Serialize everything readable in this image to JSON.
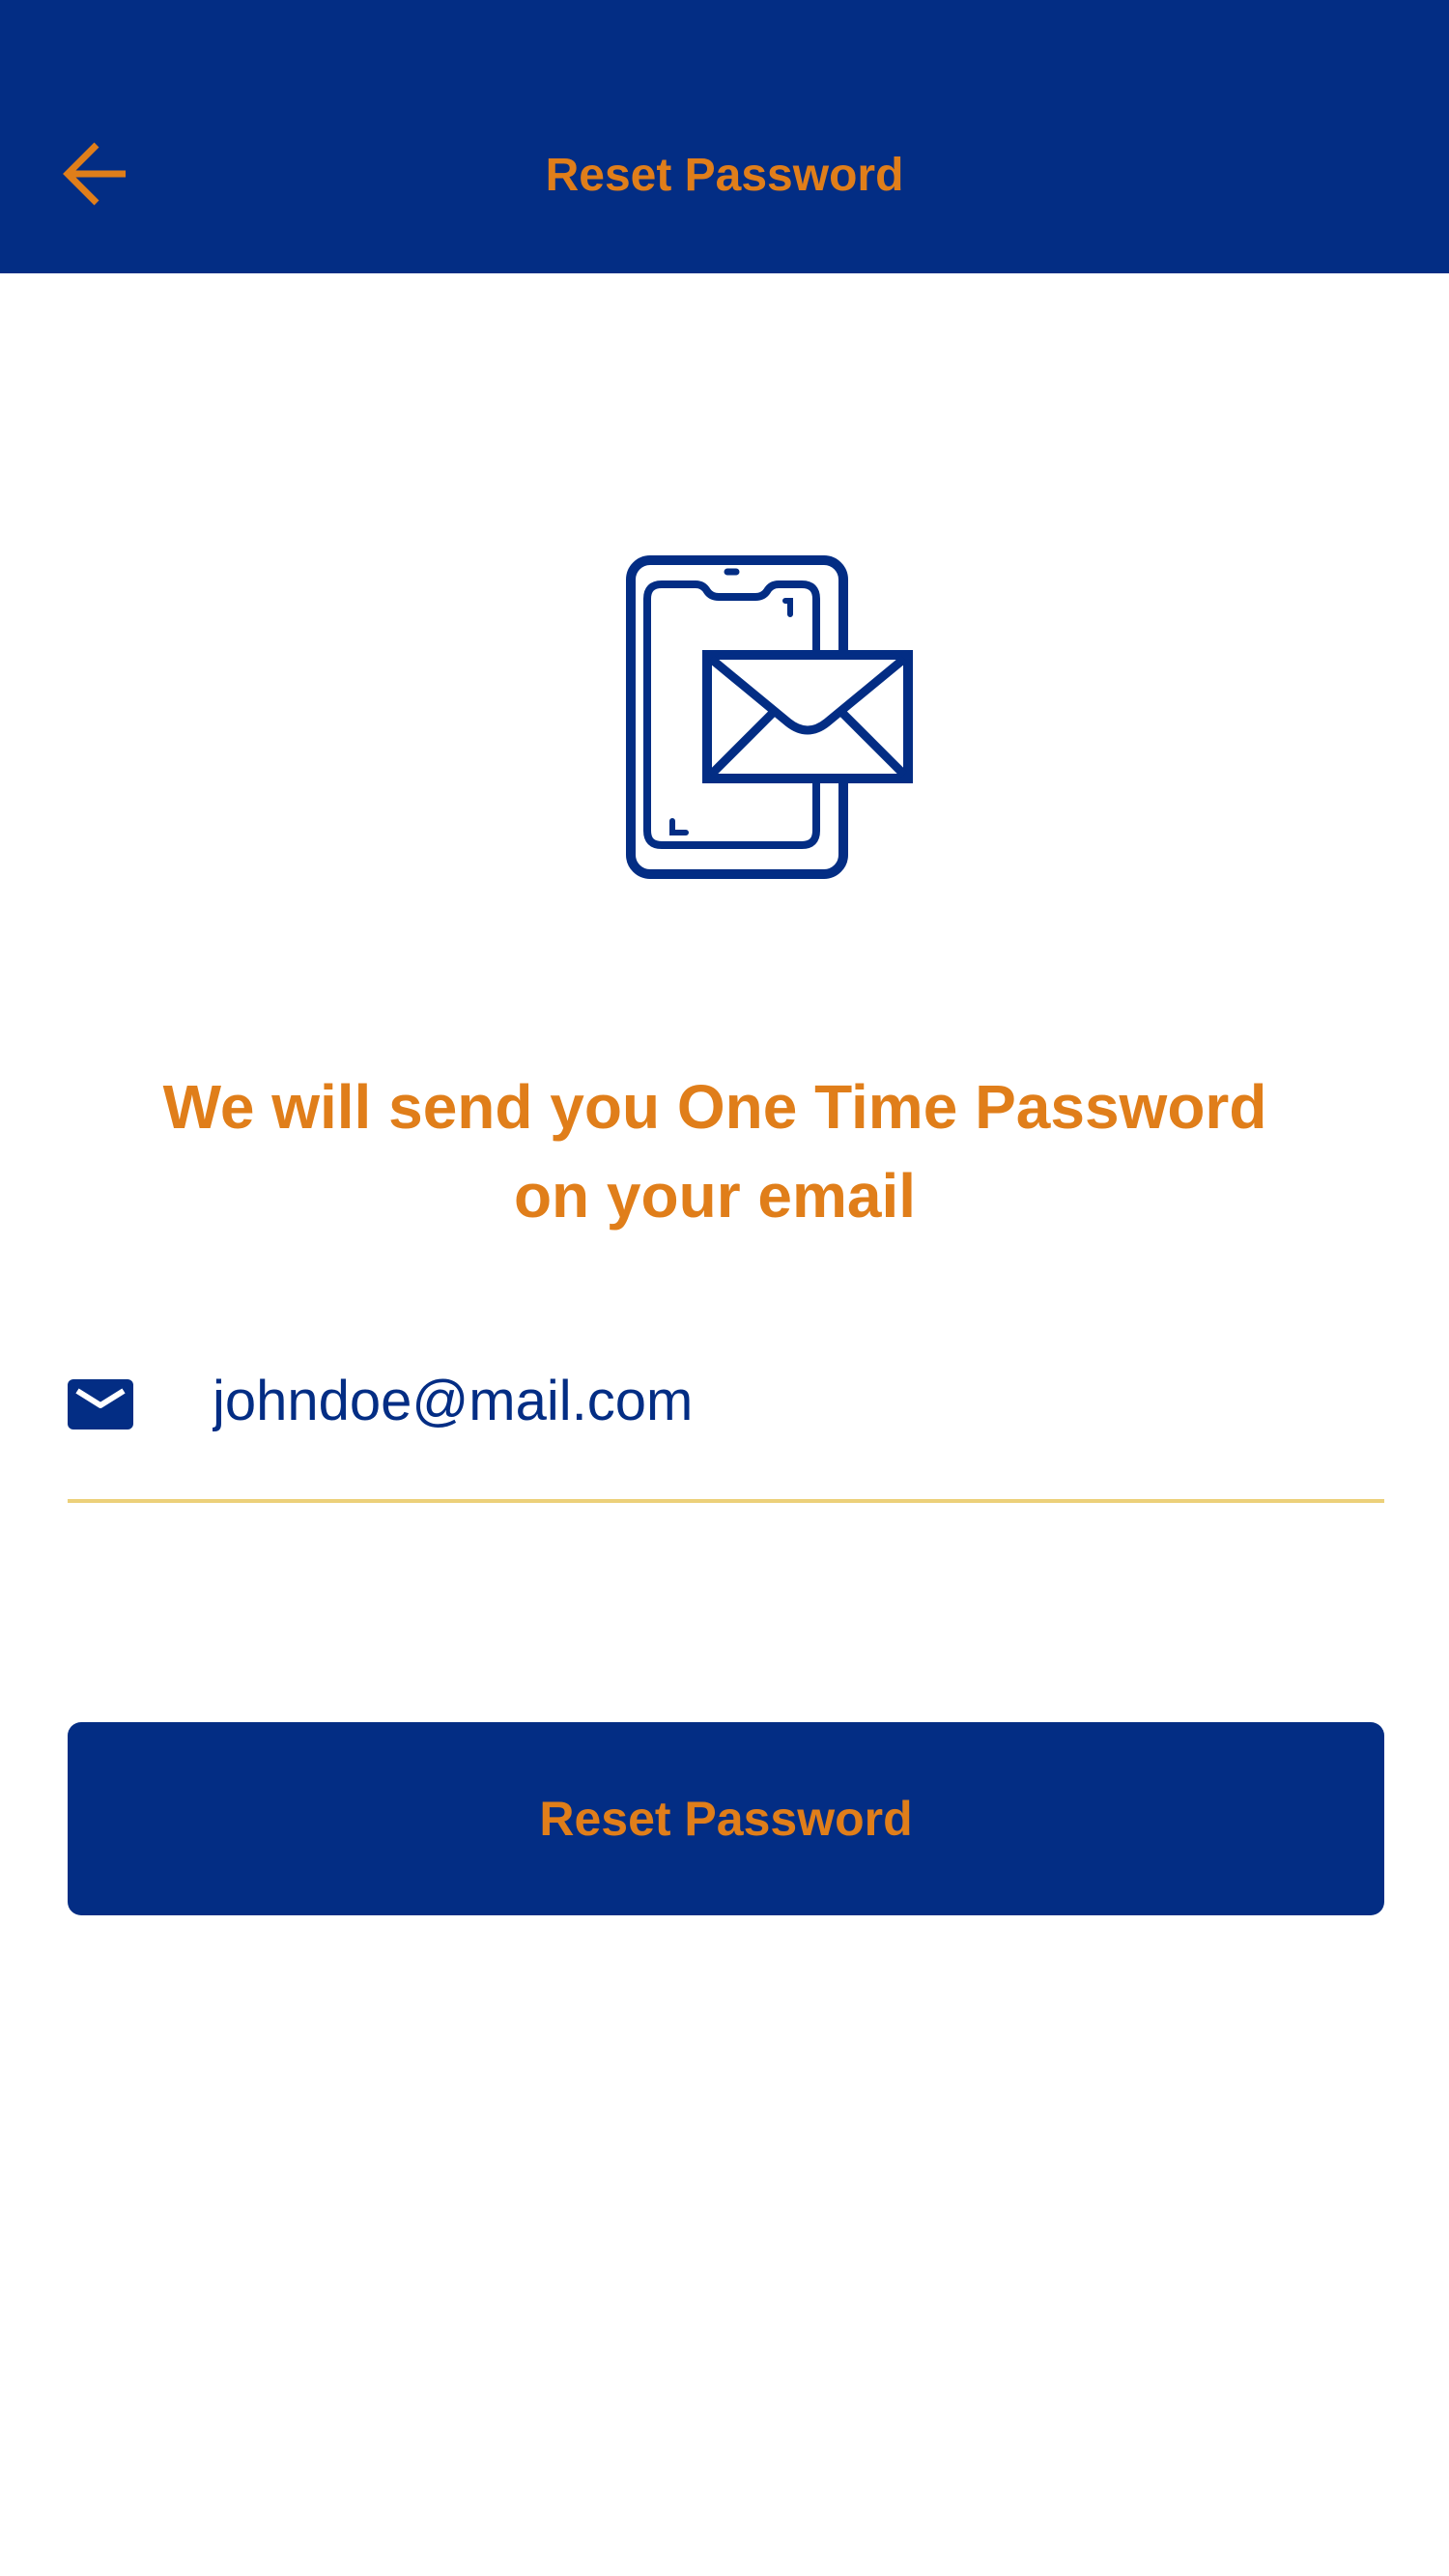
{
  "header": {
    "title": "Reset Password",
    "back_icon": "arrow-left-icon"
  },
  "illustration": {
    "icon": "phone-with-envelope-icon"
  },
  "main": {
    "headline": "We will send you One Time Password on your email"
  },
  "email_field": {
    "icon": "mail-icon",
    "value": "johndoe@mail.com"
  },
  "actions": {
    "reset_label": "Reset Password"
  },
  "colors": {
    "primary": "#032d84",
    "accent": "#e07e1a",
    "underline": "#ecd07a",
    "background": "#ffffff"
  }
}
